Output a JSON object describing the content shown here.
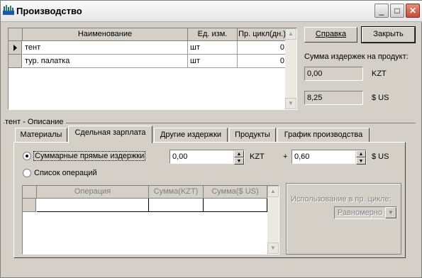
{
  "window": {
    "title": "Производство"
  },
  "products_grid": {
    "columns": [
      "Наименование",
      "Ед. изм.",
      "Пр. цикл(дн.)"
    ],
    "rows": [
      {
        "name": "тент",
        "unit": "шт",
        "cycle": "0"
      },
      {
        "name": "тур. палатка",
        "unit": "шт",
        "cycle": "0"
      }
    ]
  },
  "buttons": {
    "help": "Справка",
    "close": "Закрыть"
  },
  "costs": {
    "label": "Сумма издержек на продукт:",
    "kzt_value": "0,00",
    "kzt_unit": "KZT",
    "usd_value": "8,25",
    "usd_unit": "$ US"
  },
  "section": {
    "label": "тент - Описание"
  },
  "tabs": [
    {
      "label": "Материалы",
      "active": false
    },
    {
      "label": "Сдельная зарплата",
      "active": true
    },
    {
      "label": "Другие издержки",
      "active": false
    },
    {
      "label": "Продукты",
      "active": false
    },
    {
      "label": "График производства",
      "active": false
    }
  ],
  "piecework": {
    "option_total": "Суммарные прямые издержки",
    "option_ops": "Список операций",
    "total_kzt": "0,00",
    "kzt_unit": "KZT",
    "plus": "+",
    "total_usd": "0,60",
    "usd_unit": "$ US"
  },
  "operations_grid": {
    "columns": [
      "Операция",
      "Сумма(KZT)",
      "Сумма($ US)"
    ]
  },
  "usage": {
    "label": "Использование в пр. цикле:",
    "value": "Равномерно"
  },
  "colors": {
    "face": "#d4d0c8",
    "shadow": "#808080",
    "highlight": "#ffffff",
    "close_btn": "#c34c36"
  }
}
